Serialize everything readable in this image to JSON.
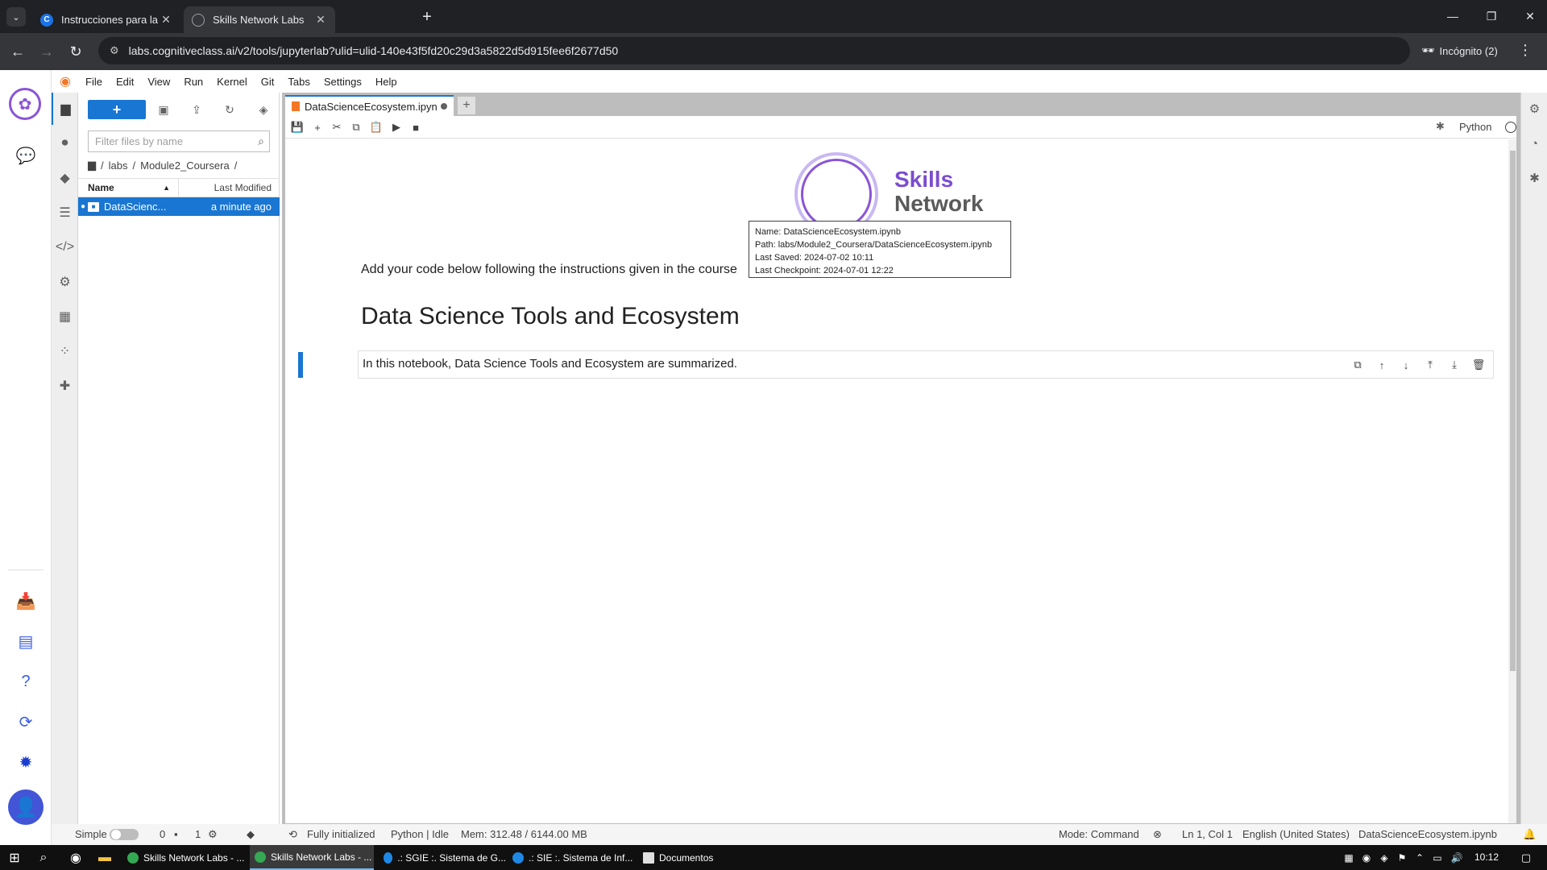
{
  "browser": {
    "tabs": [
      {
        "title": "Instrucciones para la tarea final",
        "active": false
      },
      {
        "title": "Skills Network Labs",
        "active": true
      }
    ],
    "url": "labs.cognitiveclass.ai/v2/tools/jupyterlab?ulid=ulid-140e43f5fd20c29d3a5822d5d915fee6f2677d50",
    "incognito_label": "Incógnito (2)"
  },
  "jupyter": {
    "menu": [
      "File",
      "Edit",
      "View",
      "Run",
      "Kernel",
      "Git",
      "Tabs",
      "Settings",
      "Help"
    ],
    "filebrowser": {
      "filter_placeholder": "Filter files by name",
      "breadcrumb": [
        "labs",
        "Module2_Coursera"
      ],
      "col_name": "Name",
      "col_modified": "Last Modified",
      "files": [
        {
          "name": "DataScienc...",
          "modified": "a minute ago"
        }
      ]
    },
    "doc_tab": {
      "title": "DataScienceEcosystem.ipyn"
    },
    "kernel": "Python",
    "tooltip": {
      "name": "Name: DataScienceEcosystem.ipynb",
      "path": "Path: labs/Module2_Coursera/DataScienceEcosystem.ipynb",
      "saved": "Last Saved: 2024-07-02 10:11",
      "checkpoint": "Last Checkpoint: 2024-07-01 12:22"
    },
    "notebook": {
      "logo_word1": "Skills",
      "logo_word2": "Network",
      "intro": "Add your code below following the instructions given in the course",
      "heading": "Data Science Tools and Ecosystem",
      "active_cell": "In this notebook, Data Science Tools and Ecosystem are summarized."
    },
    "status": {
      "mode_label": "Simple",
      "count1": "0",
      "count2": "1",
      "init": "Fully initialized",
      "kernel_state": "Python | Idle",
      "memory": "Mem: 312.48 / 6144.00 MB",
      "mode": "Mode: Command",
      "position": "Ln 1, Col 1",
      "language": "English (United States)",
      "file": "DataScienceEcosystem.ipynb"
    }
  },
  "taskbar": {
    "apps": [
      {
        "label": "Skills Network Labs - ...",
        "active": false
      },
      {
        "label": "Skills Network Labs - ...",
        "active": true
      },
      {
        "label": ".: SGIE :. Sistema de G...",
        "active": false
      },
      {
        "label": ".: SIE :. Sistema de Inf...",
        "active": false
      },
      {
        "label": "Documentos",
        "active": false
      }
    ],
    "time": "10:12"
  },
  "colors": {
    "accent": "#1976d2",
    "brand_purple": "#7c4dcf",
    "jupyter_orange": "#f37726"
  }
}
